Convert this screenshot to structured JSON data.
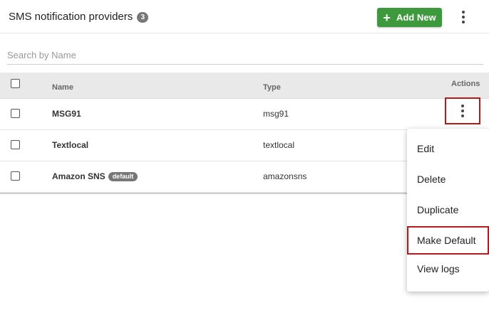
{
  "header": {
    "title": "SMS notification providers",
    "count": "3",
    "add_button_label": "Add New"
  },
  "search": {
    "placeholder": "Search by Name",
    "value": ""
  },
  "table": {
    "columns": {
      "name": "Name",
      "type": "Type",
      "actions": "Actions"
    },
    "rows": [
      {
        "name": "MSG91",
        "type": "msg91",
        "tag": ""
      },
      {
        "name": "Textlocal",
        "type": "textlocal",
        "tag": ""
      },
      {
        "name": "Amazon SNS",
        "type": "amazonsns",
        "tag": "default"
      }
    ]
  },
  "action_menu": {
    "items": [
      "Edit",
      "Delete",
      "Duplicate",
      "Make Default",
      "View logs"
    ],
    "highlighted": "Make Default"
  },
  "colors": {
    "accent_green": "#3d9a3c",
    "highlight_red": "#b8191b",
    "badge_gray": "#777777"
  },
  "icons": {
    "add": "plus-icon",
    "more": "kebab-menu-icon"
  }
}
